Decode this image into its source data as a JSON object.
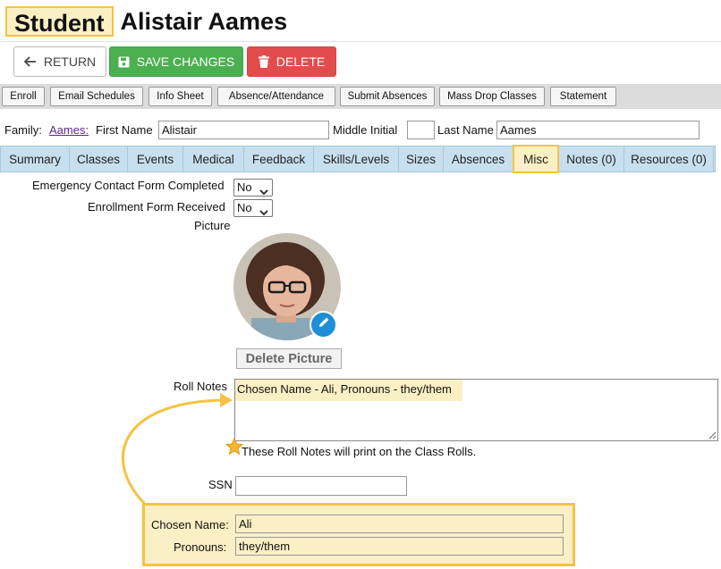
{
  "header": {
    "badge": "Student",
    "name": "Alistair Aames"
  },
  "actions": {
    "return_label": "RETURN",
    "save_label": "SAVE CHANGES",
    "delete_label": "DELETE"
  },
  "toolbar": [
    "Enroll",
    "Email Schedules",
    "Info Sheet",
    "Absence/Attendance",
    "Submit Absences",
    "Mass Drop Classes",
    "Statement"
  ],
  "name_row": {
    "family_label": "Family:",
    "family_link": "Aames:",
    "first_label": "First Name",
    "first_value": "Alistair",
    "middle_label": "Middle Initial",
    "middle_value": "",
    "last_label": "Last Name",
    "last_value": "Aames"
  },
  "tabs": [
    "Summary",
    "Classes",
    "Events",
    "Medical",
    "Feedback",
    "Skills/Levels",
    "Sizes",
    "Absences",
    "Misc",
    "Notes (0)",
    "Resources (0)"
  ],
  "active_tab": "Misc",
  "misc": {
    "emergency_label": "Emergency Contact Form Completed",
    "emergency_value": "No",
    "enrollment_label": "Enrollment Form Received",
    "enrollment_value": "No",
    "picture_label": "Picture",
    "delete_picture": "Delete Picture",
    "roll_notes_label": "Roll Notes",
    "roll_notes_value": "Chosen Name - Ali, Pronouns - they/them",
    "roll_notes_hint": "These Roll Notes will print on the Class Rolls.",
    "ssn_label": "SSN",
    "ssn_value": "",
    "chosen_name_label": "Chosen Name:",
    "chosen_name_value": "Ali",
    "pronouns_label": "Pronouns:",
    "pronouns_value": "they/them"
  },
  "colors": {
    "highlight": "#fbefc5",
    "highlight_border": "#f5c342",
    "save": "#4caf50",
    "delete": "#e34c4c",
    "tab_bar": "#c8dfef"
  },
  "icons": [
    "arrow-left-icon",
    "floppy-disk-icon",
    "trash-icon",
    "pencil-icon",
    "star-icon",
    "chevron-down-icon"
  ]
}
